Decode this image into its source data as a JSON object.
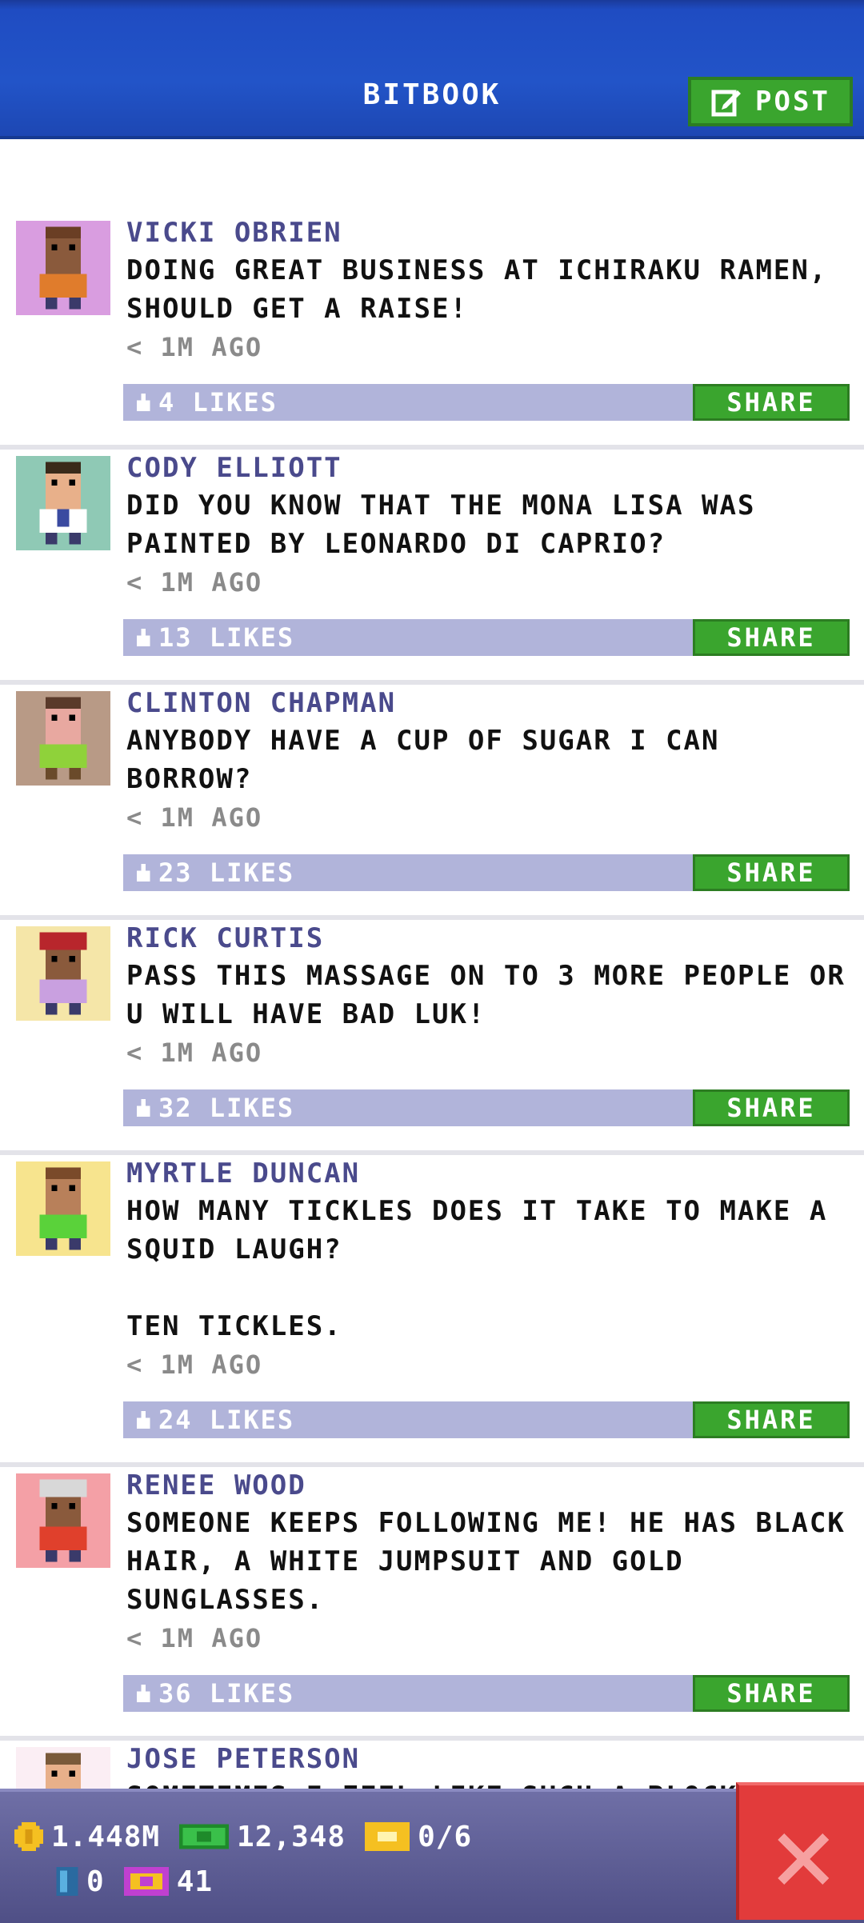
{
  "header": {
    "title": "BITBOOK",
    "post_label": "POST"
  },
  "posts": [
    {
      "author": "VICKI OBRIEN",
      "message": "DOING GREAT BUSINESS AT ICHIRAKU RAMEN, SHOULD GET A RAISE!",
      "time": "< 1M AGO",
      "likes": "4 LIKES",
      "share": "SHARE",
      "avatar_bg": "#d99de0",
      "skin": "#8a5a3c",
      "shirt": "#e07c2c"
    },
    {
      "author": "CODY ELLIOTT",
      "message": "DID YOU KNOW THAT THE MONA LISA WAS PAINTED BY LEONARDO DI CAPRIO?",
      "time": "< 1M AGO",
      "likes": "13 LIKES",
      "share": "SHARE",
      "avatar_bg": "#8fc9b5",
      "skin": "#e8b08a",
      "shirt": "#ffffff"
    },
    {
      "author": "CLINTON CHAPMAN",
      "message": "ANYBODY HAVE A CUP OF SUGAR I CAN BORROW?",
      "time": "< 1M AGO",
      "likes": "23 LIKES",
      "share": "SHARE",
      "avatar_bg": "#b89a86",
      "skin": "#e8a8a0",
      "shirt": "#8fd23a"
    },
    {
      "author": "RICK CURTIS",
      "message": "PASS THIS MASSAGE ON TO 3 MORE PEOPLE OR U WILL HAVE BAD LUK!",
      "time": "< 1M AGO",
      "likes": "32 LIKES",
      "share": "SHARE",
      "avatar_bg": "#f5e6a8",
      "skin": "#8a5a3c",
      "shirt": "#c9a0e0"
    },
    {
      "author": "MYRTLE DUNCAN",
      "message": "HOW MANY TICKLES DOES IT TAKE TO MAKE A SQUID LAUGH?\n\nTEN TICKLES.",
      "time": "< 1M AGO",
      "likes": "24 LIKES",
      "share": "SHARE",
      "avatar_bg": "#f7e48e",
      "skin": "#b8805a",
      "shirt": "#5ad23a"
    },
    {
      "author": "RENEE WOOD",
      "message": "SOMEONE KEEPS FOLLOWING ME! HE HAS BLACK HAIR, A WHITE JUMPSUIT AND GOLD SUNGLASSES.",
      "time": "< 1M AGO",
      "likes": "36 LIKES",
      "share": "SHARE",
      "avatar_bg": "#f4a0a6",
      "skin": "#8a5a3c",
      "shirt": "#e0402c"
    },
    {
      "author": "JOSE PETERSON",
      "message": "SOMETIMES I FEEL LIKE SUCH A BLOCKHEAD",
      "time": "",
      "likes": "",
      "share": "",
      "avatar_bg": "#fbeef4",
      "skin": "#e8b08a",
      "shirt": "#4a74c8"
    }
  ],
  "stats": {
    "coins": "1.448M",
    "bux": "12,348",
    "tickets": "0/6",
    "gems": "0",
    "vip": "41"
  },
  "colors": {
    "header_blue": "#2254c8",
    "accent_green": "#3aa52e",
    "like_bar": "#b1b4da",
    "author_purple": "#4a4a8c",
    "close_red": "#e23b3b"
  }
}
